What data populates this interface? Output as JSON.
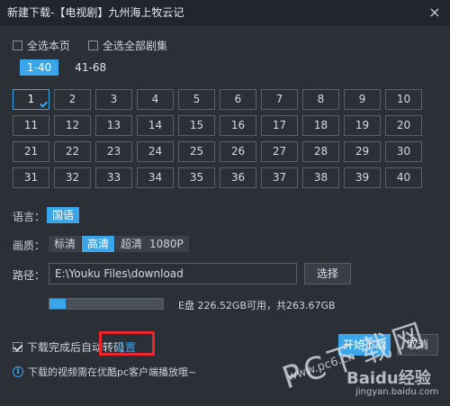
{
  "window": {
    "title": "新建下载-【电视剧】九州海上牧云记",
    "close_glyph": "×"
  },
  "select_all_page": "全选本页",
  "select_all_episodes": "全选全部剧集",
  "range_tabs": [
    {
      "label": "1-40",
      "active": true
    },
    {
      "label": "41-68",
      "active": false
    }
  ],
  "episodes": [
    "1",
    "2",
    "3",
    "4",
    "5",
    "6",
    "7",
    "8",
    "9",
    "10",
    "11",
    "12",
    "13",
    "14",
    "15",
    "16",
    "17",
    "18",
    "19",
    "20",
    "21",
    "22",
    "23",
    "24",
    "25",
    "26",
    "27",
    "28",
    "29",
    "30",
    "31",
    "32",
    "33",
    "34",
    "35",
    "36",
    "37",
    "38",
    "39",
    "40"
  ],
  "selected_episode": "1",
  "language": {
    "label": "语言：",
    "options": [
      "国语"
    ],
    "selected": "国语"
  },
  "quality": {
    "label": "画质：",
    "options": [
      "标清",
      "高清",
      "超清",
      "1080P"
    ],
    "selected": "高清"
  },
  "path": {
    "label": "路径：",
    "value": "E:\\Youku Files\\download",
    "button": "选择"
  },
  "disk": {
    "text": "E盘 226.52GB可用，共263.67GB",
    "used_fraction": 0.14
  },
  "auto_transcode": {
    "label": "下载完成后自动转码",
    "checked": true,
    "link": "设置"
  },
  "buttons": {
    "start": "开始下载",
    "cancel": "取消"
  },
  "notice": {
    "icon": "info-icon",
    "text": "下载的视频需在优酷pc客户端播放哦~"
  },
  "watermark": {
    "text": "PC下载网",
    "baidu": "Baidu经验",
    "baidu_url": "jingyan.baidu.com",
    "url": "www.pc6.cn"
  },
  "colors": {
    "accent": "#3aa5e8",
    "highlight": "#e8262b",
    "background": "#2b2f36"
  }
}
